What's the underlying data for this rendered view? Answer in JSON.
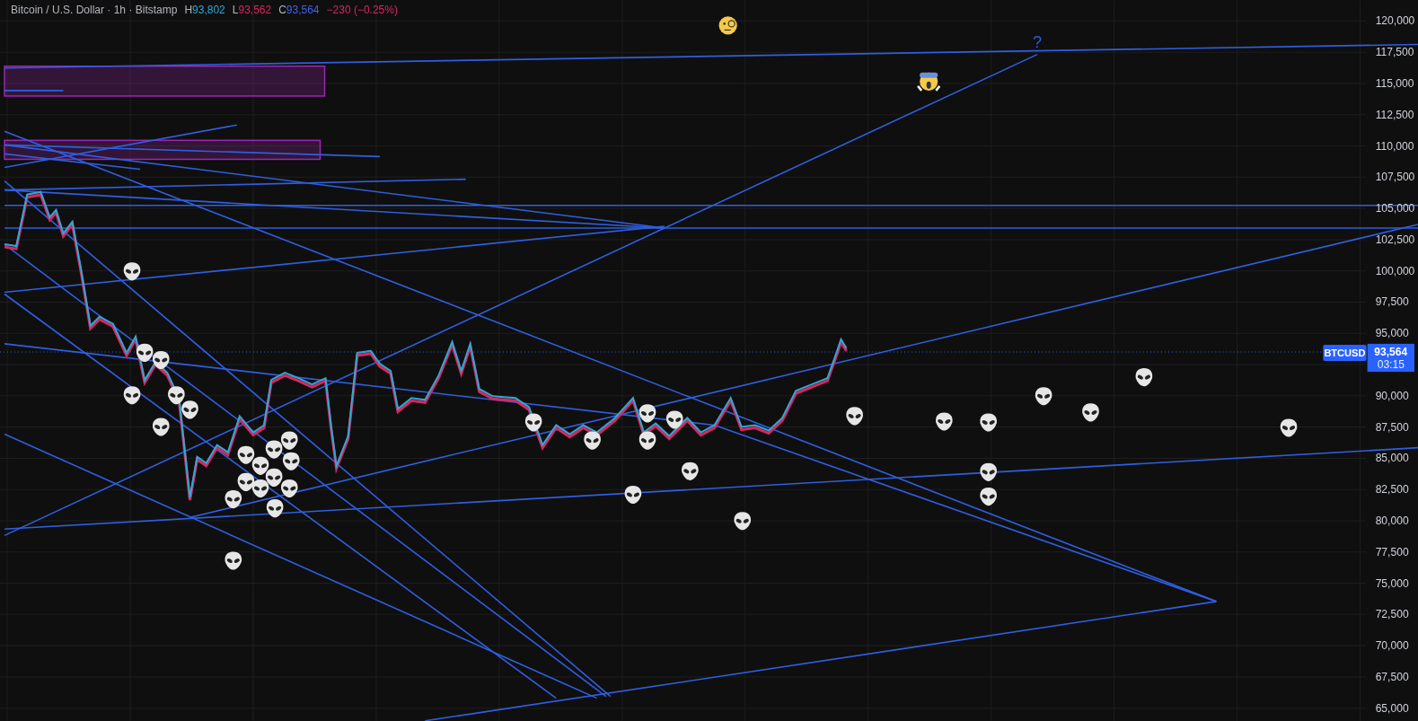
{
  "legend": {
    "symbol": "Bitcoin / U.S. Dollar · 1h · Bitstamp",
    "ohlc": [
      {
        "label": "H",
        "value": "93,802",
        "color": "#2fa8d6"
      },
      {
        "label": "L",
        "value": "93,562",
        "color": "#d9275f"
      },
      {
        "label": "C",
        "value": "93,564",
        "color": "#3f64e8"
      }
    ],
    "change": "−230 (−0.25%)"
  },
  "annotation": {
    "text": "?"
  },
  "price_axis": {
    "ticks": [
      "120,000",
      "117,500",
      "115,000",
      "112,500",
      "110,000",
      "107,500",
      "105,000",
      "102,500",
      "100,000",
      "97,500",
      "95,000",
      "90,000",
      "87,500",
      "85,000",
      "82,500",
      "80,000",
      "77,500",
      "75,000",
      "72,500",
      "70,000",
      "67,500",
      "65,000"
    ]
  },
  "price_tag": {
    "symbol": "BTCUSD",
    "price": "93,564",
    "countdown": "03:15"
  }
}
